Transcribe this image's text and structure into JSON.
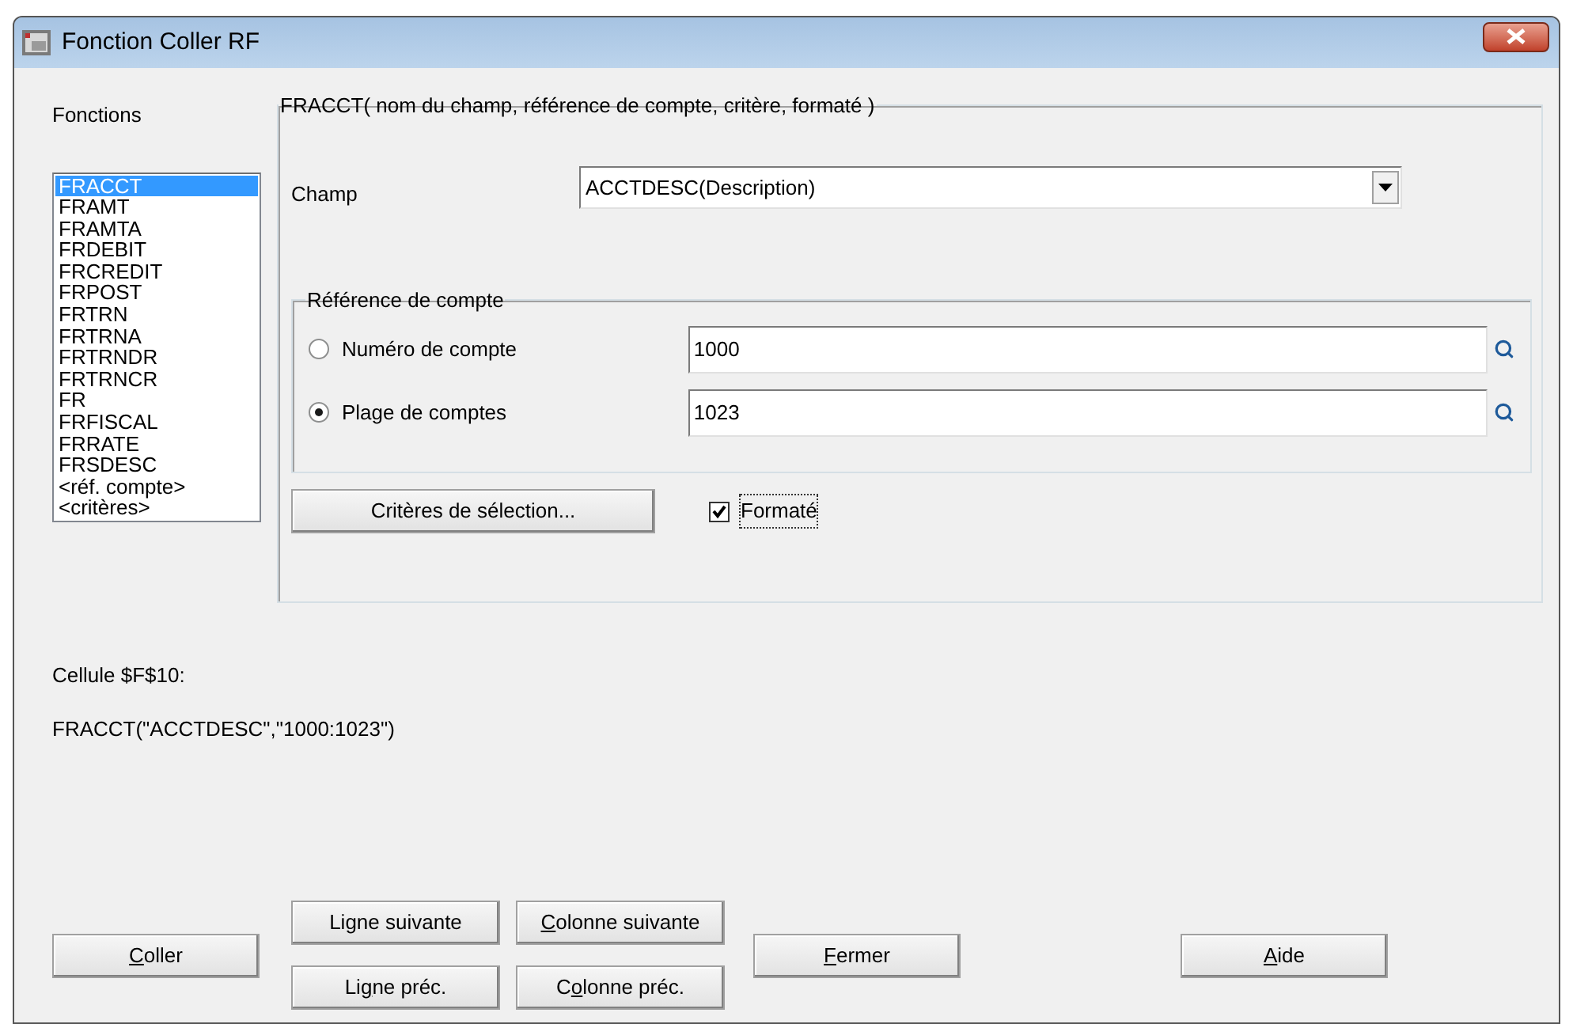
{
  "window": {
    "title": "Fonction Coller RF"
  },
  "functions": {
    "label": "Fonctions",
    "items": [
      {
        "label": "FRACCT",
        "selected": true
      },
      {
        "label": "FRAMT",
        "selected": false
      },
      {
        "label": "FRAMTA",
        "selected": false
      },
      {
        "label": "FRDEBIT",
        "selected": false
      },
      {
        "label": "FRCREDIT",
        "selected": false
      },
      {
        "label": "FRPOST",
        "selected": false
      },
      {
        "label": "FRTRN",
        "selected": false
      },
      {
        "label": "FRTRNA",
        "selected": false
      },
      {
        "label": "FRTRNDR",
        "selected": false
      },
      {
        "label": "FRTRNCR",
        "selected": false
      },
      {
        "label": "FR",
        "selected": false
      },
      {
        "label": "FRFISCAL",
        "selected": false
      },
      {
        "label": "FRRATE",
        "selected": false
      },
      {
        "label": "FRSDESC",
        "selected": false
      },
      {
        "label": "<réf. compte>",
        "selected": false
      },
      {
        "label": "<critères>",
        "selected": false
      }
    ]
  },
  "group": {
    "title": "FRACCT( nom du champ, référence de compte, critère, formaté )",
    "field": {
      "label": "Champ",
      "value": "ACCTDESC(Description)"
    },
    "account_ref": {
      "title": "Référence de compte",
      "options": [
        {
          "label": "Numéro de compte",
          "value": "1000",
          "selected": false
        },
        {
          "label": "Plage de comptes",
          "value": "1023",
          "selected": true
        }
      ]
    },
    "criteria_button": "Critères de sélection...",
    "formatted": {
      "label": "Formaté",
      "checked": true
    }
  },
  "cell_label": "Cellule $F$10:",
  "formula": "FRACCT(\"ACCTDESC\",\"1000:1023\")",
  "button_columns": [
    [
      {
        "key": "C",
        "post": "oller"
      }
    ],
    [
      {
        "pre": "Li",
        "key": "g",
        "post": "ne suivante"
      },
      {
        "pre": "Li",
        "key": "g",
        "post": "ne préc."
      }
    ],
    [
      {
        "key": "C",
        "post": "olonne suivante"
      },
      {
        "pre": "C",
        "key": "o",
        "post": "lonne préc."
      }
    ],
    [
      {
        "key": "F",
        "post": "ermer"
      }
    ],
    [
      {
        "key": "A",
        "post": "ide"
      }
    ]
  ]
}
